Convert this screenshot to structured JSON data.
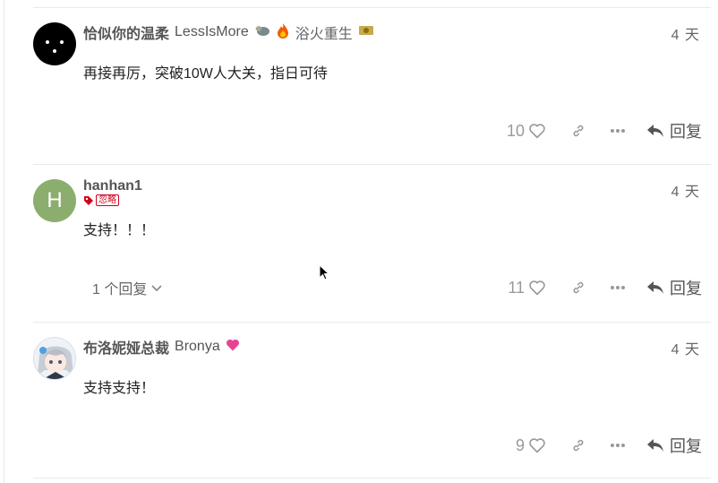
{
  "posts": [
    {
      "username": "恰似你的温柔",
      "full_name": "LessIsMore",
      "flair": "浴火重生",
      "date": "4 天",
      "content": "再接再厉，突破10W人大关，指日可待",
      "likes": "10",
      "reply_label": "回复"
    },
    {
      "username": "hanhan1",
      "avatar_letter": "H",
      "avatar_color": "#8bae6e",
      "tag": "忽略",
      "date": "4 天",
      "content": "支持！！！",
      "replies_toggle": "1 个回复",
      "likes": "11",
      "reply_label": "回复"
    },
    {
      "username": "布洛妮娅总裁",
      "full_name": "Bronya",
      "date": "4 天",
      "content": "支持支持！",
      "likes": "9",
      "reply_label": "回复"
    }
  ],
  "colors": {
    "divider": "#e9e9e9",
    "tag_red": "#d0021b",
    "heart": "#e84393"
  }
}
